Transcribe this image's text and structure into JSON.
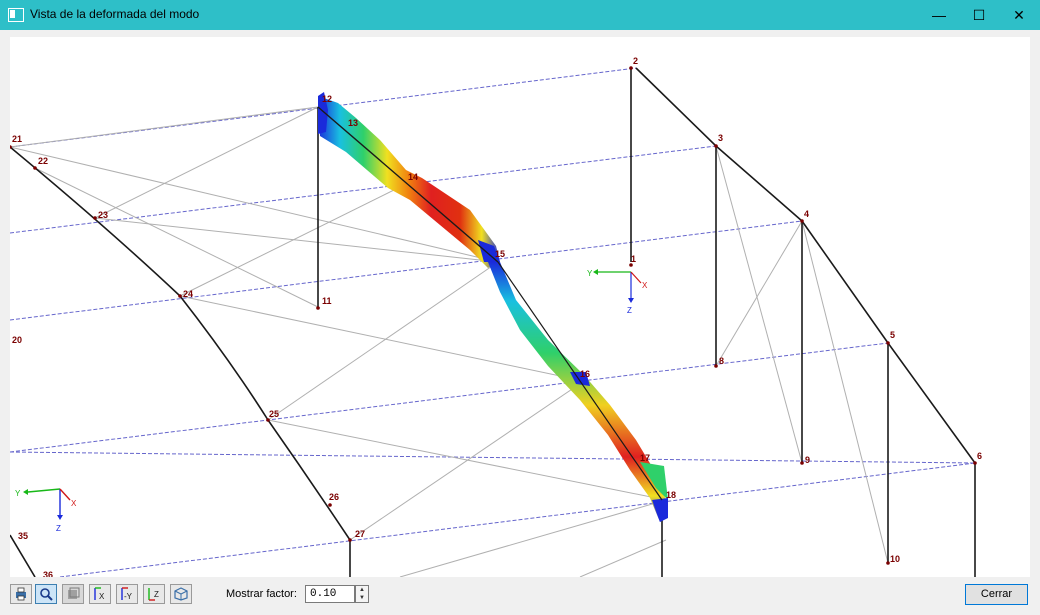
{
  "window": {
    "title": "Vista de la deformada del modo",
    "minimize_glyph": "—",
    "maximize_glyph": "☐",
    "close_glyph": "✕"
  },
  "model": {
    "nodes": [
      "1",
      "2",
      "3",
      "4",
      "5",
      "6",
      "8",
      "9",
      "10",
      "11",
      "12",
      "13",
      "14",
      "15",
      "16",
      "17",
      "18",
      "20",
      "21",
      "22",
      "23",
      "24",
      "25",
      "26",
      "27",
      "35",
      "36"
    ],
    "axis_center": {
      "x": "X",
      "y": "Y",
      "z": "Z"
    },
    "axis_corner": {
      "x": "X",
      "y": "Y",
      "z": "Z"
    }
  },
  "toolbar": {
    "buttons": [
      "print-icon",
      "zoom-icon",
      "render-icon",
      "view-x-icon",
      "view-y-icon",
      "view-z-icon",
      "view-iso-icon"
    ],
    "view_x_label": "X",
    "view_y_label": "-Y",
    "view_z_label": "Z",
    "factor_label": "Mostrar factor:",
    "factor_value": "0.10",
    "close_label": "Cerrar"
  },
  "colors": {
    "titlebar": "#2ebfc8",
    "beam": "#6666cc",
    "member": "#1a1a1a",
    "brace": "#b0b0b0",
    "node_label": "#7a0000"
  }
}
